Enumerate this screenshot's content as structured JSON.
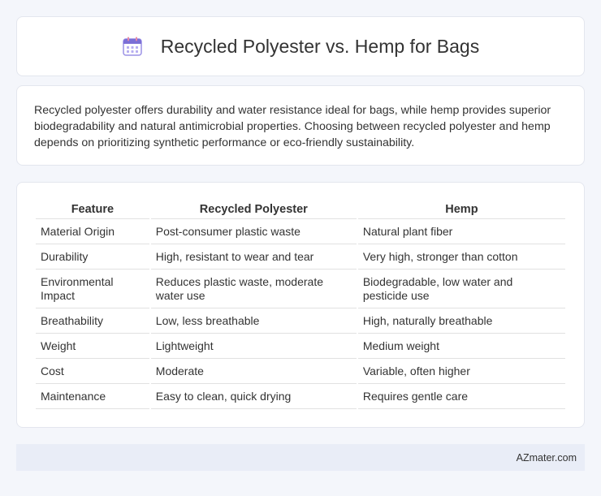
{
  "header": {
    "title": "Recycled Polyester vs. Hemp for Bags",
    "icon": "calendar-icon"
  },
  "intro": {
    "text": "Recycled polyester offers durability and water resistance ideal for bags, while hemp provides superior biodegradability and natural antimicrobial properties. Choosing between recycled polyester and hemp depends on prioritizing synthetic performance or eco-friendly sustainability."
  },
  "table": {
    "headers": [
      "Feature",
      "Recycled Polyester",
      "Hemp"
    ],
    "rows": [
      [
        "Material Origin",
        "Post-consumer plastic waste",
        "Natural plant fiber"
      ],
      [
        "Durability",
        "High, resistant to wear and tear",
        "Very high, stronger than cotton"
      ],
      [
        "Environmental Impact",
        "Reduces plastic waste, moderate water use",
        "Biodegradable, low water and pesticide use"
      ],
      [
        "Breathability",
        "Low, less breathable",
        "High, naturally breathable"
      ],
      [
        "Weight",
        "Lightweight",
        "Medium weight"
      ],
      [
        "Cost",
        "Moderate",
        "Variable, often higher"
      ],
      [
        "Maintenance",
        "Easy to clean, quick drying",
        "Requires gentle care"
      ]
    ]
  },
  "footer": {
    "brand": "AZmater.com"
  },
  "colors": {
    "background": "#f4f6fb",
    "card": "#ffffff",
    "footer": "#e9edf7",
    "icon_purple": "#7b6fd6",
    "icon_pink": "#e88aa6"
  }
}
